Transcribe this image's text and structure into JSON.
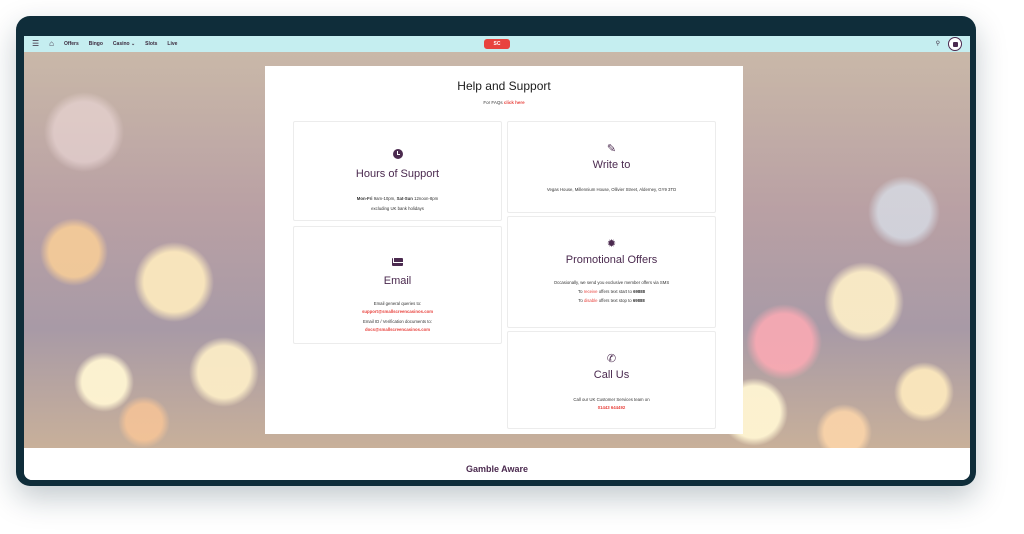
{
  "nav": {
    "links": [
      "Offers",
      "Bingo",
      "Casino ⌄",
      "Slots",
      "Live"
    ],
    "logo_text": "SC"
  },
  "page": {
    "title": "Help and Support",
    "faq_prefix": "For FAQs",
    "faq_link": "click here"
  },
  "cards": {
    "hours": {
      "title": "Hours of Support",
      "weekday_bold": "Mon-Fri",
      "weekday_hours": "9am-10pm,",
      "weekend_bold": "Sat-Sun",
      "weekend_hours": "12noon-8pm",
      "note": "excluding UK bank holidays"
    },
    "write": {
      "title": "Write to",
      "address": "Vegas House, Millennium House, Ollivier Street, Alderney, GY9 3TD"
    },
    "email": {
      "title": "Email",
      "general_label": "Email general queries to:",
      "general_address": "support@smallscreencasinos.com",
      "docs_label": "Email ID / Verification documents to:",
      "docs_address": "docs@smallscreencasinos.com"
    },
    "promo": {
      "title": "Promotional Offers",
      "intro": "Occasionally, we send you exclusive member offers via SMS",
      "receive_prefix": "To",
      "receive_word": "receive",
      "receive_suffix": "offers text start to",
      "receive_number": "69888",
      "disable_prefix": "To",
      "disable_word": "disable",
      "disable_suffix": "offers text stop to",
      "disable_number": "69888"
    },
    "call": {
      "title": "Call Us",
      "text": "Call our UK Customer Services team on",
      "number": "01443 644492"
    }
  },
  "footer": {
    "gamble_title": "Gamble Aware"
  }
}
